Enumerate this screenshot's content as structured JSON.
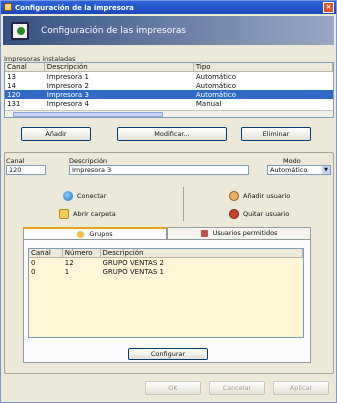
{
  "window": {
    "title": "Configuración de la impresora",
    "close_glyph": "×"
  },
  "header": {
    "title": "Configuración de las impresoras"
  },
  "printers": {
    "section_label": "Impresoras instaladas",
    "columns": [
      "Canal",
      "Descripción",
      "Tipo"
    ],
    "rows": [
      {
        "channel": "13",
        "description": "Impresora 1",
        "type": "Automático",
        "selected": false
      },
      {
        "channel": "14",
        "description": "Impresora 2",
        "type": "Automático",
        "selected": false
      },
      {
        "channel": "120",
        "description": "Impresora 3",
        "type": "Automático",
        "selected": true
      },
      {
        "channel": "131",
        "description": "Impresora 4",
        "type": "Manual",
        "selected": false
      }
    ]
  },
  "actions": {
    "add": "Añadir",
    "modify": "Modificar...",
    "delete": "Eliminar"
  },
  "detail": {
    "channel_label": "Canal",
    "channel_value": "120",
    "description_label": "Descripción",
    "description_value": "Impresora 3",
    "mode_label": "Modo",
    "mode_value": "Automático"
  },
  "links": {
    "connect": "Conectar",
    "open_folder": "Abrir carpeta",
    "add_user": "Añadir usuario",
    "remove_user": "Quitar usuario"
  },
  "tabs": [
    {
      "label": "Grupos",
      "active": true
    },
    {
      "label": "Usuarios permitidos",
      "active": false
    }
  ],
  "groups_table": {
    "columns": [
      "Canal",
      "Número",
      "Descripción"
    ],
    "rows": [
      {
        "channel": "0",
        "number": "12",
        "description": "GRUPO VENTAS 2"
      },
      {
        "channel": "0",
        "number": "1",
        "description": "GRUPO VENTAS 1"
      }
    ],
    "footer_label": "Configurar"
  },
  "dialog_buttons": {
    "ok": "OK",
    "cancel": "Cancelar",
    "apply": "Aplicar"
  }
}
